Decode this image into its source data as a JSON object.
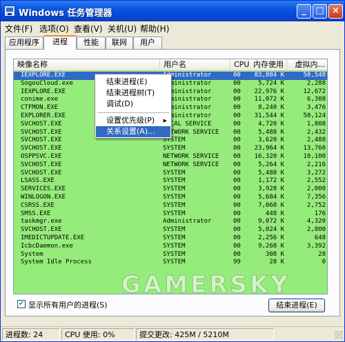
{
  "window": {
    "title": "Windows 任务管理器"
  },
  "menu": [
    {
      "label": "文件(F)"
    },
    {
      "label": "选项(O)"
    },
    {
      "label": "查看(V)"
    },
    {
      "label": "关机(U)"
    },
    {
      "label": "帮助(H)"
    }
  ],
  "tabs": [
    {
      "label": "应用程序"
    },
    {
      "label": "进程"
    },
    {
      "label": "性能"
    },
    {
      "label": "联网"
    },
    {
      "label": "用户"
    }
  ],
  "active_tab": "进程",
  "columns": {
    "name": "映像名称",
    "user": "用户名",
    "cpu": "CPU",
    "mem": "内存使用",
    "vm": "虚拟内..."
  },
  "processes": [
    {
      "name": "IEXPLORE.EXE",
      "user": "Administrator",
      "cpu": "00",
      "mem": "83,884 K",
      "vm": "50,548",
      "selected": true
    },
    {
      "name": "SogouCloud.exe",
      "user": "Administrator",
      "cpu": "00",
      "mem": "5,724 K",
      "vm": "2,288"
    },
    {
      "name": "IEXPLORE.EXE",
      "user": "Administrator",
      "cpu": "00",
      "mem": "22,976 K",
      "vm": "12,672"
    },
    {
      "name": "conime.exe",
      "user": "Administrator",
      "cpu": "00",
      "mem": "11,072 K",
      "vm": "6,308"
    },
    {
      "name": "CTFMON.EXE",
      "user": "Administrator",
      "cpu": "00",
      "mem": "8,240 K",
      "vm": "3,476"
    },
    {
      "name": "EXPLORER.EXE",
      "user": "Administrator",
      "cpu": "00",
      "mem": "31,544 K",
      "vm": "50,124"
    },
    {
      "name": "SVCHOST.EXE",
      "user": "LOCAL SERVICE",
      "cpu": "00",
      "mem": "4,720 K",
      "vm": "1,808"
    },
    {
      "name": "SVCHOST.EXE",
      "user": "NETWORK SERVICE",
      "cpu": "00",
      "mem": "5,488 K",
      "vm": "2,432"
    },
    {
      "name": "SVCHOST.EXE",
      "user": "SYSTEM",
      "cpu": "00",
      "mem": "3,620 K",
      "vm": "2,488"
    },
    {
      "name": "SVCHOST.EXE",
      "user": "SYSTEM",
      "cpu": "00",
      "mem": "23,964 K",
      "vm": "13,760"
    },
    {
      "name": "OSPPSVC.EXE",
      "user": "NETWORK SERVICE",
      "cpu": "00",
      "mem": "16,320 K",
      "vm": "10,100"
    },
    {
      "name": "SVCHOST.EXE",
      "user": "NETWORK SERVICE",
      "cpu": "00",
      "mem": "5,264 K",
      "vm": "2,216"
    },
    {
      "name": "SVCHOST.EXE",
      "user": "SYSTEM",
      "cpu": "00",
      "mem": "5,488 K",
      "vm": "3,272"
    },
    {
      "name": "LSASS.EXE",
      "user": "SYSTEM",
      "cpu": "00",
      "mem": "1,172 K",
      "vm": "2,552"
    },
    {
      "name": "SERVICES.EXE",
      "user": "SYSTEM",
      "cpu": "00",
      "mem": "3,928 K",
      "vm": "2,008"
    },
    {
      "name": "WINLOGON.EXE",
      "user": "SYSTEM",
      "cpu": "00",
      "mem": "5,684 K",
      "vm": "7,356"
    },
    {
      "name": "CSRSS.EXE",
      "user": "SYSTEM",
      "cpu": "00",
      "mem": "7,068 K",
      "vm": "2,752"
    },
    {
      "name": "SMSS.EXE",
      "user": "SYSTEM",
      "cpu": "00",
      "mem": "448 K",
      "vm": "176"
    },
    {
      "name": "taskmgr.exe",
      "user": "Administrator",
      "cpu": "00",
      "mem": "9,072 K",
      "vm": "4,320"
    },
    {
      "name": "SVCHOST.EXE",
      "user": "SYSTEM",
      "cpu": "00",
      "mem": "5,024 K",
      "vm": "2,800"
    },
    {
      "name": "IMEDICTUPDATE.EXE",
      "user": "SYSTEM",
      "cpu": "00",
      "mem": "2,256 K",
      "vm": "648"
    },
    {
      "name": "IcbcDaemon.exe",
      "user": "SYSTEM",
      "cpu": "00",
      "mem": "9,268 K",
      "vm": "3,392"
    },
    {
      "name": "System",
      "user": "SYSTEM",
      "cpu": "00",
      "mem": "308 K",
      "vm": "28"
    },
    {
      "name": "System Idle Process",
      "user": "SYSTEM",
      "cpu": "99",
      "mem": "28 K",
      "vm": "0"
    }
  ],
  "context_menu": {
    "items": [
      {
        "label": "结束进程(E)"
      },
      {
        "label": "结束进程树(T)"
      },
      {
        "label": "调试(D)"
      },
      {
        "label": "设置优先级(P)",
        "submenu": true
      },
      {
        "label": "关系设置(A)..."
      }
    ],
    "highlighted": "关系设置(A)..."
  },
  "show_all_users": {
    "label": "显示所有用户的进程(S)",
    "checked": true
  },
  "end_process_button": "结束进程(E)",
  "watermark": "GAMERSKY",
  "statusbar": {
    "processes": "进程数: 24",
    "cpu": "CPU 使用: 0%",
    "commit": "提交更改: 425M / 5210M"
  },
  "colors": {
    "listview_bg": "#96ec7a",
    "selection": "#316ac5",
    "titlebar": "#0a55e0"
  }
}
